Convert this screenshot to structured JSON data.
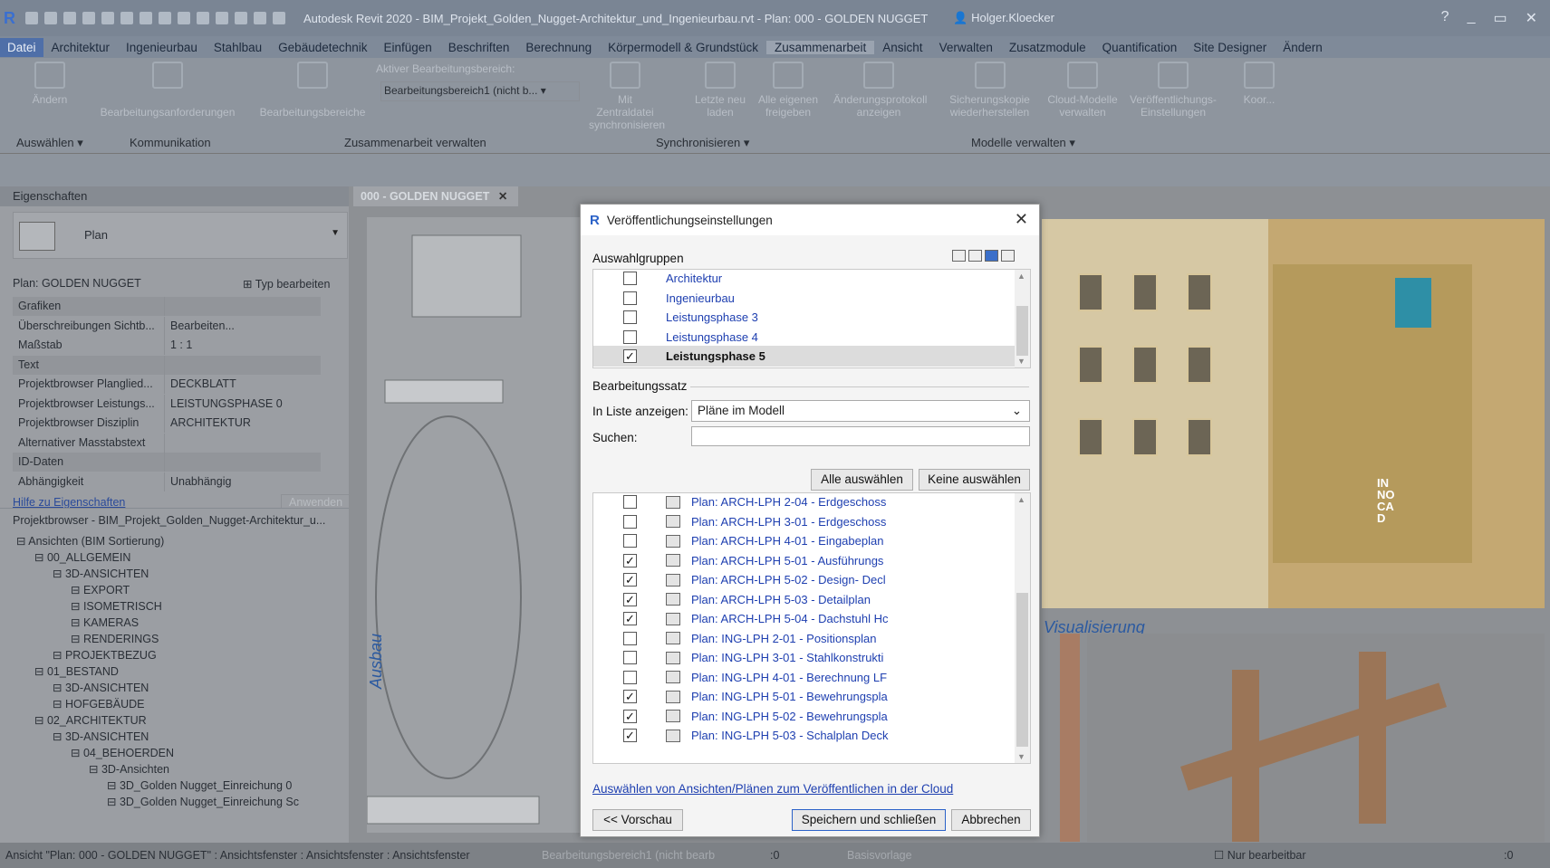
{
  "titlebar": {
    "title": "Autodesk Revit 2020 - BIM_Projekt_Golden_Nugget-Architektur_und_Ingenieurbau.rvt - Plan: 000 - GOLDEN NUGGET",
    "user": "Holger.Kloecker",
    "help": "?"
  },
  "menu": [
    "Datei",
    "Architektur",
    "Ingenieurbau",
    "Stahlbau",
    "Gebäudetechnik",
    "Einfügen",
    "Beschriften",
    "Berechnung",
    "Körpermodell & Grundstück",
    "Zusammenarbeit",
    "Ansicht",
    "Verwalten",
    "Zusatzmodule",
    "Quantification",
    "Site Designer",
    "Ändern"
  ],
  "ribbon": {
    "aendern": "Ändern",
    "bearbeitungsanforderungen": "Bearbeitungsanforderungen",
    "bearbeitungsbereiche": "Bearbeitungsbereiche",
    "aktiver_label": "Aktiver Bearbeitungsbereich:",
    "aktiver_value": "Bearbeitungsbereich1 (nicht b...",
    "mit_zentraldatei": "Mit Zentraldatei synchronisieren",
    "letzte_neu": "Letzte neu laden",
    "alle_eigenen": "Alle eigenen freigeben",
    "aenderungsprotokoll": "Änderungsprotokoll anzeigen",
    "sicherungskopie": "Sicherungskopie wiederherstellen",
    "cloud_modelle": "Cloud-Modelle verwalten",
    "veroeffentlichungs": "Veröffentlichungs-Einstellungen",
    "koor": "Koor...",
    "groups": {
      "auswaehlen": "Auswählen ▾",
      "kommunikation": "Kommunikation",
      "zusammenarbeit": "Zusammenarbeit verwalten",
      "synchronisieren": "Synchronisieren ▾",
      "modelle": "Modelle verwalten ▾"
    }
  },
  "properties": {
    "header": "Eigenschaften",
    "type": "Plan",
    "plan_label": "Plan: GOLDEN NUGGET",
    "typ_bearbeiten": "Typ bearbeiten",
    "rows": [
      {
        "k": "Grafiken",
        "v": "",
        "section": true
      },
      {
        "k": "Überschreibungen Sichtb...",
        "v": "Bearbeiten..."
      },
      {
        "k": "Maßstab",
        "v": "1 : 1"
      },
      {
        "k": "Text",
        "v": "",
        "section": true
      },
      {
        "k": "Projektbrowser Planglied...",
        "v": "DECKBLATT"
      },
      {
        "k": "Projektbrowser Leistungs...",
        "v": "LEISTUNGSPHASE 0"
      },
      {
        "k": "Projektbrowser Disziplin",
        "v": "ARCHITEKTUR"
      },
      {
        "k": "Alternativer Masstabstext",
        "v": ""
      },
      {
        "k": "ID-Daten",
        "v": "",
        "section": true
      },
      {
        "k": "Abhängigkeit",
        "v": "Unabhängig"
      }
    ],
    "hilfe": "Hilfe zu Eigenschaften",
    "anwenden": "Anwenden"
  },
  "browser": {
    "title": "Projektbrowser - BIM_Projekt_Golden_Nugget-Architektur_u...",
    "items": [
      {
        "t": "Ansichten (BIM Sortierung)",
        "d": 0
      },
      {
        "t": "00_ALLGEMEIN",
        "d": 1
      },
      {
        "t": "3D-ANSICHTEN",
        "d": 2
      },
      {
        "t": "EXPORT",
        "d": 3
      },
      {
        "t": "ISOMETRISCH",
        "d": 3
      },
      {
        "t": "KAMERAS",
        "d": 3
      },
      {
        "t": "RENDERINGS",
        "d": 3
      },
      {
        "t": "PROJEKTBEZUG",
        "d": 2
      },
      {
        "t": "01_BESTAND",
        "d": 1
      },
      {
        "t": "3D-ANSICHTEN",
        "d": 2
      },
      {
        "t": "HOFGEBÄUDE",
        "d": 2
      },
      {
        "t": "02_ARCHITEKTUR",
        "d": 1
      },
      {
        "t": "3D-ANSICHTEN",
        "d": 2
      },
      {
        "t": "04_BEHOERDEN",
        "d": 3
      },
      {
        "t": "3D-Ansichten",
        "d": 4
      },
      {
        "t": "3D_Golden Nugget_Einreichung 0",
        "d": 5
      },
      {
        "t": "3D_Golden Nugget_Einreichung Sc",
        "d": 5
      }
    ]
  },
  "view": {
    "tab": "000 - GOLDEN NUGGET",
    "ausbau": "Ausbau",
    "visualisierung": "Visualisierung",
    "logo": "IN NO CA D"
  },
  "dialog": {
    "title": "Veröffentlichungseinstellungen",
    "auswahlgruppen": "Auswahlgruppen",
    "groups": [
      {
        "t": "Architektur",
        "c": false
      },
      {
        "t": "Ingenieurbau",
        "c": false
      },
      {
        "t": "Leistungsphase 3",
        "c": false
      },
      {
        "t": "Leistungsphase 4",
        "c": false
      },
      {
        "t": "Leistungsphase 5",
        "c": true,
        "sel": true
      }
    ],
    "bearbeitungssatz": "Bearbeitungssatz",
    "in_liste": "In Liste anzeigen:",
    "in_liste_value": "Pläne im Modell",
    "suchen": "Suchen:",
    "alle_auswaehlen": "Alle auswählen",
    "keine_auswaehlen": "Keine auswählen",
    "plans": [
      {
        "t": "Plan: ARCH-LPH 2-04 - Erdgeschoss",
        "c": false
      },
      {
        "t": "Plan: ARCH-LPH 3-01 - Erdgeschoss",
        "c": false
      },
      {
        "t": "Plan: ARCH-LPH 4-01 - Eingabeplan",
        "c": false
      },
      {
        "t": "Plan: ARCH-LPH 5-01 - Ausführungs",
        "c": true
      },
      {
        "t": "Plan: ARCH-LPH 5-02 - Design- Decl",
        "c": true
      },
      {
        "t": "Plan: ARCH-LPH 5-03 - Detailplan",
        "c": true
      },
      {
        "t": "Plan: ARCH-LPH 5-04 - Dachstuhl Hc",
        "c": true
      },
      {
        "t": "Plan: ING-LPH 2-01 - Positionsplan",
        "c": false
      },
      {
        "t": "Plan: ING-LPH 3-01 - Stahlkonstrukti",
        "c": false
      },
      {
        "t": "Plan: ING-LPH 4-01 - Berechnung LF",
        "c": false
      },
      {
        "t": "Plan: ING-LPH 5-01 - Bewehrungspla",
        "c": true
      },
      {
        "t": "Plan: ING-LPH 5-02 - Bewehrungspla",
        "c": true
      },
      {
        "t": "Plan: ING-LPH 5-03 - Schalplan Deck",
        "c": true
      }
    ],
    "cloud_link": "Auswählen von Ansichten/Plänen zum Veröffentlichen in der Cloud",
    "zurueck": "<< Vorschau",
    "speichern": "Speichern und schließen",
    "abbrechen": "Abbrechen"
  },
  "statusbar": {
    "text": "Ansicht \"Plan: 000 - GOLDEN NUGGET\" : Ansichtsfenster : Ansichtsfenster : Ansichtsfenster",
    "workset": "Bearbeitungsbereich1 (nicht bearb",
    "zero": ":0",
    "basisvorlage": "Basisvorlage",
    "nur": "Nur bearbeitbar",
    "filter": ":0"
  }
}
